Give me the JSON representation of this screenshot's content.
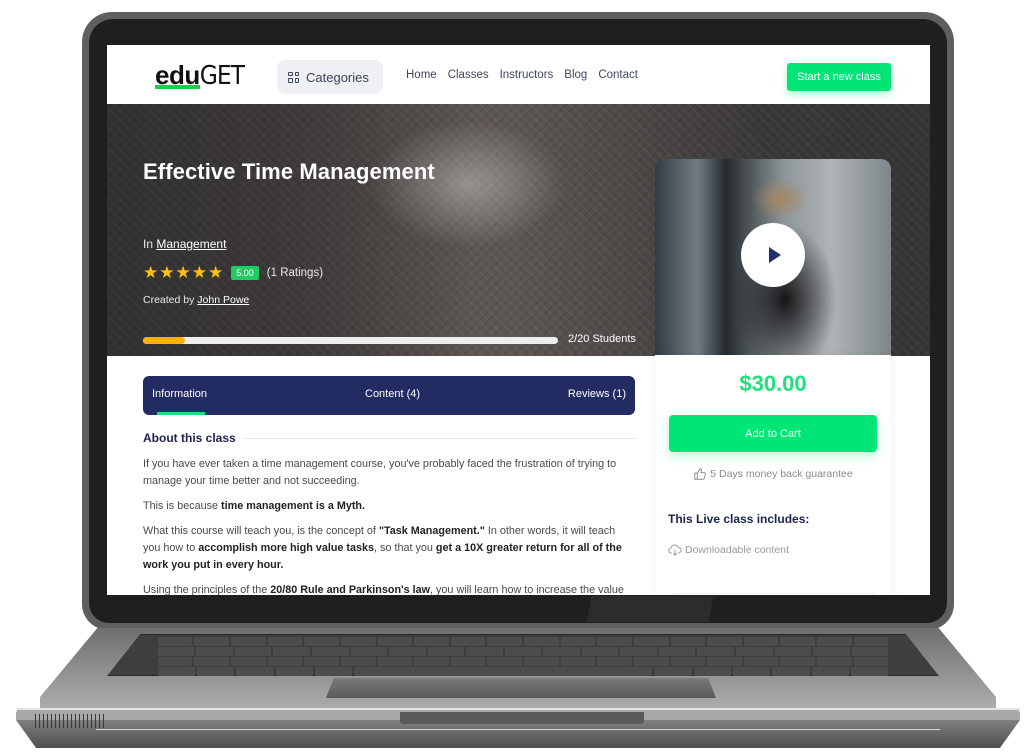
{
  "navbar": {
    "logo_bold": "edu",
    "logo_light": "GET",
    "categories_label": "Categories",
    "links": [
      "Home",
      "Classes",
      "Instructors",
      "Blog",
      "Contact"
    ],
    "cta_label": "Start a new class"
  },
  "hero": {
    "title": "Effective Time Management",
    "category_prefix": "In",
    "category": "Management",
    "rating_stars": 5,
    "rating_score": "5.00",
    "ratings_count": "(1 Ratings)",
    "created_by_prefix": "Created by",
    "author": "John Powe",
    "enrolled": 2,
    "capacity": 20,
    "students_label": "2/20 Students",
    "icons": {
      "star": "star-icon",
      "play": "play-icon"
    }
  },
  "tabs": [
    {
      "label": "Information",
      "active": true
    },
    {
      "label": "Content (4)",
      "active": false
    },
    {
      "label": "Reviews (1)",
      "active": false
    }
  ],
  "about": {
    "heading": "About this class",
    "p1": "If you have ever taken a time management course, you've probably faced the frustration of trying to manage your time better and not succeeding.",
    "p2_plain": "This is because ",
    "p2_bold": "time management is a Myth.",
    "p3_a": "What this course will teach you, is the concept of ",
    "p3_b": "\"Task Management.\"",
    "p3_c": " In other words, it will teach you how to ",
    "p3_d": "accomplish more high value tasks",
    "p3_e": ", so that you ",
    "p3_f": "get a 10X greater return for all of the work you put in every hour.",
    "p4_a": "Using the principles of the ",
    "p4_b": "20/80 Rule and Parkinson's law",
    "p4_c": ", you will learn how to increase the value of t"
  },
  "sidebar": {
    "price": "$30.00",
    "add_to_cart": "Add to Cart",
    "guarantee": "5 Days money back guarantee",
    "includes_title": "This Live class includes:",
    "includes": [
      "Downloadable content"
    ]
  }
}
